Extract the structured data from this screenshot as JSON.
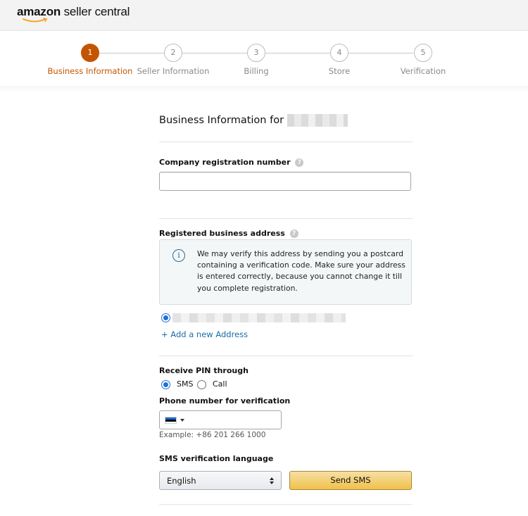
{
  "header": {
    "logo_brand": "amazon",
    "logo_product": "seller central"
  },
  "stepper": {
    "steps": [
      {
        "number": "1",
        "label": "Business Information",
        "active": true
      },
      {
        "number": "2",
        "label": "Seller Information",
        "active": false
      },
      {
        "number": "3",
        "label": "Billing",
        "active": false
      },
      {
        "number": "4",
        "label": "Store",
        "active": false
      },
      {
        "number": "5",
        "label": "Verification",
        "active": false
      }
    ]
  },
  "form": {
    "title": "Business Information for",
    "company_reg_label": "Company registration number",
    "company_reg_value": "",
    "address_label": "Registered business address",
    "address_info": "We may verify this address by sending you a postcard containing a verification code. Make sure your address is entered correctly, because you cannot change it till you complete registration.",
    "add_address_link": "+ Add a new Address",
    "pin_label": "Receive PIN through",
    "pin_options": {
      "sms": "SMS",
      "call": "Call",
      "selected": "SMS"
    },
    "phone_label": "Phone number for verification",
    "phone_value": "",
    "phone_example": "Example: +86 201 266 1000",
    "sms_lang_label": "SMS verification language",
    "sms_lang_selected": "English",
    "send_sms_label": "Send SMS"
  },
  "icons": {
    "help": "question-circle-icon",
    "info": "info-circle-icon",
    "flag": "estonia-flag-icon"
  },
  "colors": {
    "accent": "#c45500",
    "link": "#1a6da8",
    "button_yellow": "#f0c14b",
    "radio_blue": "#1e6fd9"
  }
}
